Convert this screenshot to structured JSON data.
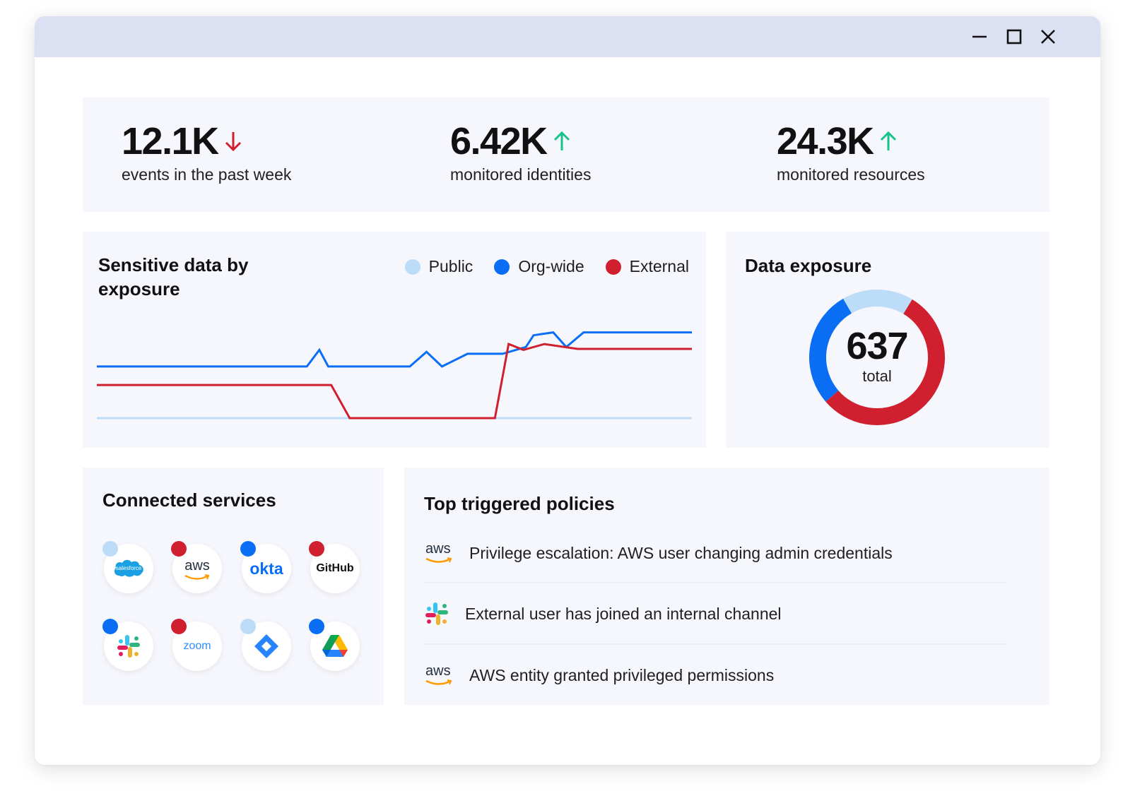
{
  "colors": {
    "titlebar": "#dbe0f3",
    "card": "#f6f7fc",
    "public": "#bcdcf8",
    "org_wide": "#0a6ef5",
    "external": "#d01f2e",
    "trend_down": "#d01f2e",
    "trend_up": "#17c389"
  },
  "window_controls": [
    "minimize-icon",
    "maximize-icon",
    "close-icon"
  ],
  "stats": [
    {
      "value": "12.1K",
      "trend": "down",
      "label": "events in the past week"
    },
    {
      "value": "6.42K",
      "trend": "up",
      "label": "monitored identities"
    },
    {
      "value": "24.3K",
      "trend": "up",
      "label": "monitored resources"
    }
  ],
  "sensitive_chart": {
    "title": "Sensitive data by exposure",
    "legend": [
      {
        "key": "public",
        "label": "Public"
      },
      {
        "key": "org_wide",
        "label": "Org-wide"
      },
      {
        "key": "external",
        "label": "External"
      }
    ]
  },
  "chart_data": {
    "type": "line",
    "title": "Sensitive data by exposure",
    "xlim": [
      0,
      100
    ],
    "ylim": [
      0,
      100
    ],
    "grid": false,
    "legend_position": "top-right",
    "series": [
      {
        "name": "Public",
        "color": "#bcdcf8",
        "points": [
          [
            0,
            0
          ],
          [
            100,
            0
          ]
        ]
      },
      {
        "name": "Org-wide",
        "color": "#0a6ef5",
        "points": [
          [
            0,
            53
          ],
          [
            35.3,
            53
          ],
          [
            37.4,
            70
          ],
          [
            38.9,
            53
          ],
          [
            52.6,
            53
          ],
          [
            55.4,
            68
          ],
          [
            58,
            53
          ],
          [
            62.3,
            66
          ],
          [
            68.2,
            66
          ],
          [
            72.1,
            73
          ],
          [
            73.4,
            85
          ],
          [
            76.7,
            88
          ],
          [
            78.9,
            73
          ],
          [
            81.8,
            88
          ],
          [
            100,
            88
          ]
        ]
      },
      {
        "name": "External",
        "color": "#d01f2e",
        "points": [
          [
            0,
            34
          ],
          [
            39.4,
            34
          ],
          [
            42.5,
            0
          ],
          [
            66.9,
            0
          ],
          [
            69.2,
            76
          ],
          [
            71.7,
            70
          ],
          [
            75.2,
            76
          ],
          [
            80.8,
            71
          ],
          [
            100,
            71
          ]
        ]
      }
    ]
  },
  "data_exposure": {
    "title": "Data exposure",
    "total": "637",
    "total_label": "total",
    "segments": [
      {
        "name": "Public",
        "fraction": 0.17,
        "color": "#bcdcf8"
      },
      {
        "name": "External",
        "fraction": 0.55,
        "color": "#d01f2e"
      },
      {
        "name": "Org-wide",
        "fraction": 0.28,
        "color": "#0a6ef5"
      }
    ]
  },
  "connected_services": {
    "title": "Connected services",
    "items": [
      {
        "name": "salesforce",
        "status": "public",
        "logo_text": "salesforce"
      },
      {
        "name": "aws",
        "status": "external",
        "logo_text": "aws"
      },
      {
        "name": "okta",
        "status": "org_wide",
        "logo_text": "okta"
      },
      {
        "name": "github",
        "status": "external",
        "logo_text": "GitHub"
      },
      {
        "name": "slack",
        "status": "org_wide",
        "logo_text": ""
      },
      {
        "name": "zoom",
        "status": "external",
        "logo_text": "zoom"
      },
      {
        "name": "jira",
        "status": "public",
        "logo_text": ""
      },
      {
        "name": "google-drive",
        "status": "org_wide",
        "logo_text": ""
      }
    ]
  },
  "policies": {
    "title": "Top triggered policies",
    "items": [
      {
        "icon": "aws-icon",
        "icon_text": "aws",
        "text": "Privilege escalation: AWS user changing admin credentials"
      },
      {
        "icon": "slack-icon",
        "icon_text": "",
        "text": "External user has joined an internal channel"
      },
      {
        "icon": "aws-icon",
        "icon_text": "aws",
        "text": "AWS entity granted privileged permissions"
      }
    ]
  }
}
